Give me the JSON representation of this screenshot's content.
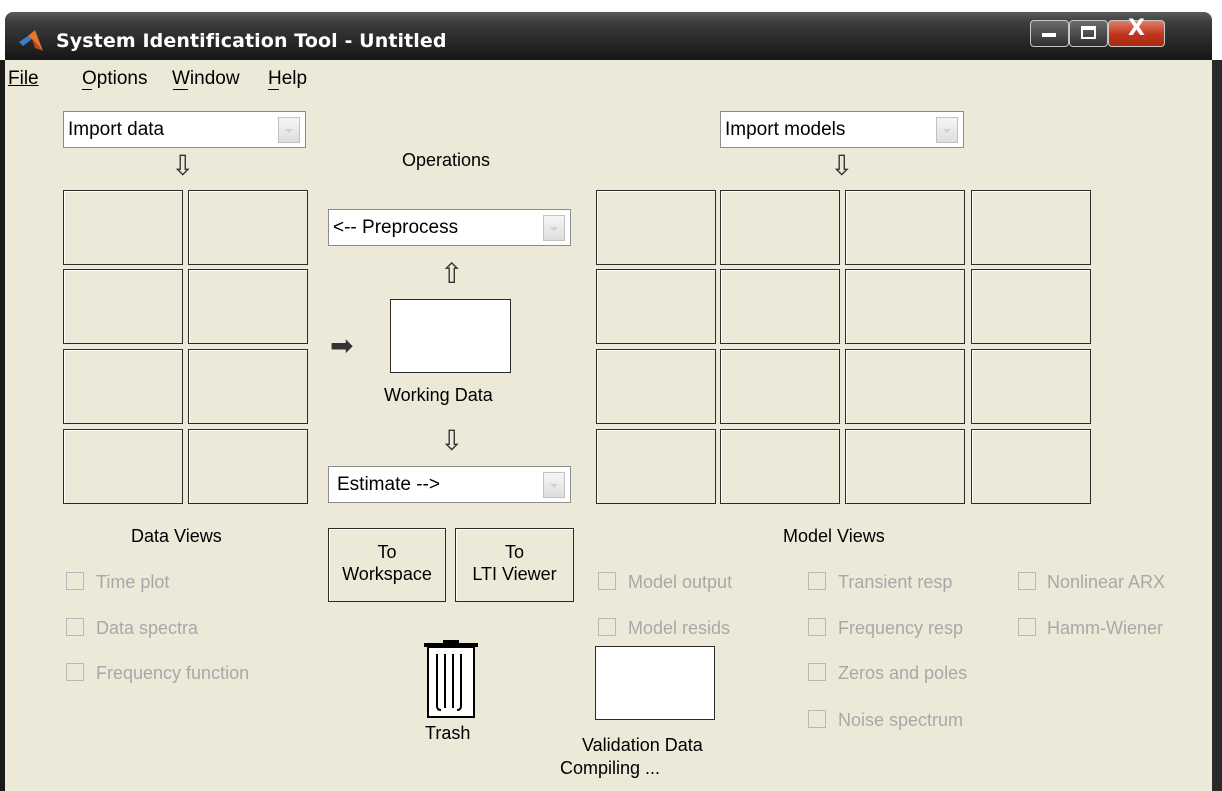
{
  "window": {
    "title": "System Identification Tool - Untitled",
    "close_glyph": "X"
  },
  "menu": {
    "items": [
      {
        "label": "File"
      },
      {
        "label": "Options"
      },
      {
        "label": "Window"
      },
      {
        "label": "Help"
      }
    ]
  },
  "data": {
    "import_popup": "Import data",
    "views_title": "Data Views",
    "views": [
      {
        "label": "Time plot",
        "checked": false,
        "enabled": false
      },
      {
        "label": "Data spectra",
        "checked": false,
        "enabled": false
      },
      {
        "label": "Frequency function",
        "checked": false,
        "enabled": false
      }
    ]
  },
  "operations": {
    "title": "Operations",
    "preprocess_popup": "<-- Preprocess",
    "working_data_label": "Working Data",
    "estimate_popup": "Estimate -->",
    "to_workspace_line1": "To",
    "to_workspace_line2": "Workspace",
    "to_lti_line1": "To",
    "to_lti_line2": "LTI Viewer",
    "trash_label": "Trash"
  },
  "models": {
    "import_popup": "Import models",
    "views_title": "Model Views",
    "views_col1": [
      {
        "label": "Model output",
        "checked": false,
        "enabled": false
      },
      {
        "label": "Model resids",
        "checked": false,
        "enabled": false
      }
    ],
    "views_col2": [
      {
        "label": "Transient resp",
        "checked": false,
        "enabled": false
      },
      {
        "label": "Frequency resp",
        "checked": false,
        "enabled": false
      },
      {
        "label": "Zeros and poles",
        "checked": false,
        "enabled": false
      },
      {
        "label": "Noise spectrum",
        "checked": false,
        "enabled": false
      }
    ],
    "views_col3": [
      {
        "label": "Nonlinear ARX",
        "checked": false,
        "enabled": false
      },
      {
        "label": "Hamm-Wiener",
        "checked": false,
        "enabled": false
      }
    ]
  },
  "validation": {
    "label": "Validation Data",
    "status": "Compiling ..."
  },
  "colors": {
    "client_background": "#ece9d8",
    "titlebar": "#151515",
    "close_button": "#c0331c",
    "disabled_text": "#a8a8a8"
  },
  "icons": [
    "matlab-logo-icon",
    "minimize-icon",
    "maximize-icon",
    "close-icon",
    "down-arrow-icon",
    "up-arrow-icon",
    "right-arrow-icon",
    "trash-icon",
    "dropdown-arrow-icon"
  ]
}
